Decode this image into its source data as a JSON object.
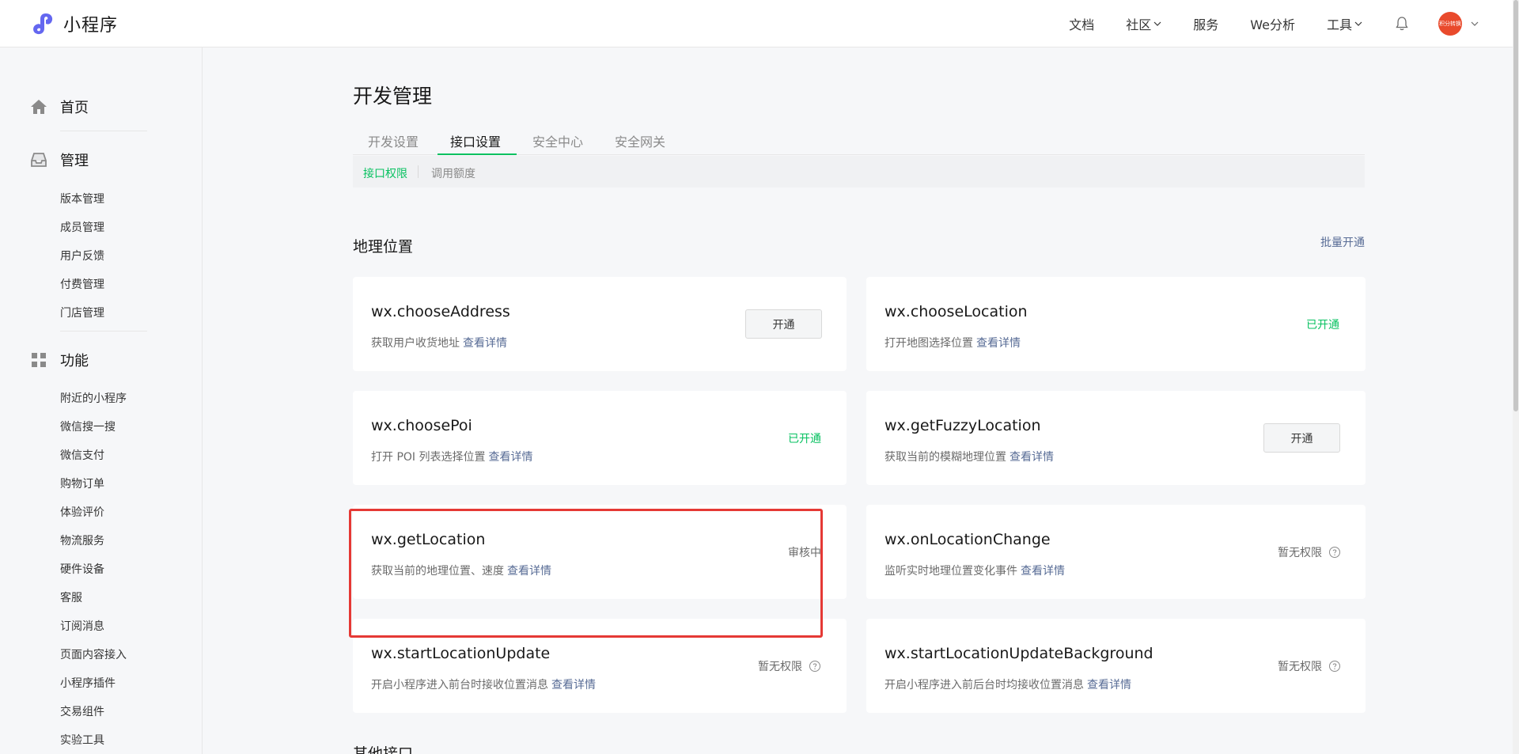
{
  "app": {
    "logo_text": "小程序"
  },
  "topnav": {
    "items": [
      {
        "label": "文档"
      },
      {
        "label": "社区"
      },
      {
        "label": "服务"
      },
      {
        "label": "We分析"
      },
      {
        "label": "工具"
      }
    ],
    "avatar_text": "积分转换"
  },
  "sidebar": {
    "home": "首页",
    "manage": {
      "label": "管理",
      "items": [
        "版本管理",
        "成员管理",
        "用户反馈",
        "付费管理",
        "门店管理"
      ]
    },
    "features": {
      "label": "功能",
      "items": [
        "附近的小程序",
        "微信搜一搜",
        "微信支付",
        "购物订单",
        "体验评价",
        "物流服务",
        "硬件设备",
        "客服",
        "订阅消息",
        "页面内容接入",
        "小程序插件",
        "交易组件",
        "实验工具"
      ]
    }
  },
  "main": {
    "title": "开发管理",
    "tabs": [
      "开发设置",
      "接口设置",
      "安全中心",
      "安全网关"
    ],
    "active_tab": "接口设置",
    "subtabs": [
      "接口权限",
      "调用额度"
    ],
    "section": {
      "title": "地理位置",
      "batch_link": "批量开通"
    },
    "detail_link": "查看详情",
    "cards": [
      {
        "name": "wx.chooseAddress",
        "desc": "获取用户收货地址",
        "status": "开通",
        "status_type": "button"
      },
      {
        "name": "wx.chooseLocation",
        "desc": "打开地图选择位置",
        "status": "已开通",
        "status_type": "ok"
      },
      {
        "name": "wx.choosePoi",
        "desc": "打开 POI 列表选择位置",
        "status": "已开通",
        "status_type": "ok"
      },
      {
        "name": "wx.getFuzzyLocation",
        "desc": "获取当前的模糊地理位置",
        "status": "开通",
        "status_type": "button"
      },
      {
        "name": "wx.getLocation",
        "desc": "获取当前的地理位置、速度",
        "status": "审核中",
        "status_type": "review"
      },
      {
        "name": "wx.onLocationChange",
        "desc": "监听实时地理位置变化事件",
        "status": "暂无权限",
        "status_type": "none"
      },
      {
        "name": "wx.startLocationUpdate",
        "desc": "开启小程序进入前台时接收位置消息",
        "status": "暂无权限",
        "status_type": "none"
      },
      {
        "name": "wx.startLocationUpdateBackground",
        "desc": "开启小程序进入前后台时均接收位置消息",
        "status": "暂无权限",
        "status_type": "none"
      }
    ],
    "next_section_title": "其他接口"
  },
  "colors": {
    "accent_green": "#07c160",
    "link_blue": "#576b95",
    "highlight_red": "#e53935"
  }
}
